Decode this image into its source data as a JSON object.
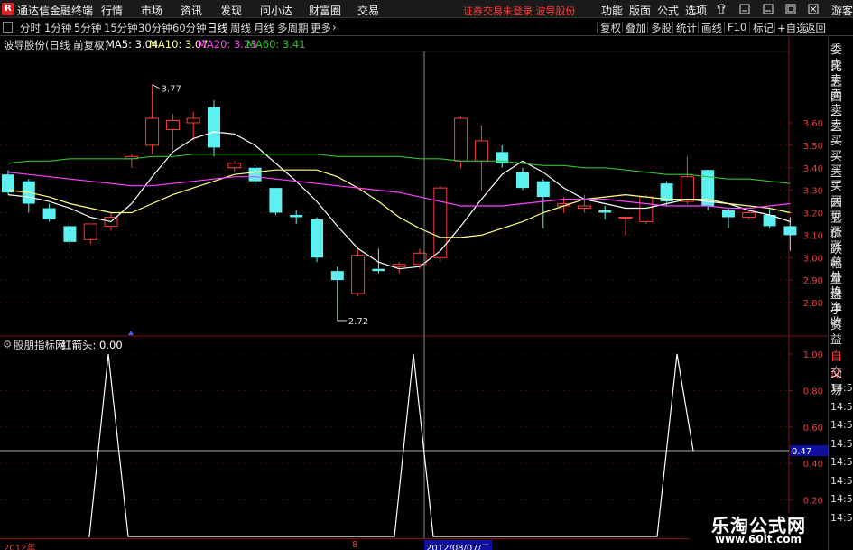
{
  "menubar": {
    "logo": "R",
    "app_title": "通达信金融终端",
    "menus": [
      "行情",
      "市场",
      "资讯",
      "发现",
      "问小达",
      "财富圈",
      "交易"
    ],
    "notice": "证券交易未登录  波导股份",
    "right_menus": [
      "功能",
      "版面",
      "公式",
      "选项"
    ],
    "guest": "游客"
  },
  "toolbar": {
    "periods": [
      "分时",
      "1分钟",
      "5分钟",
      "15分钟",
      "30分钟",
      "60分钟",
      "日线",
      "周线",
      "月线",
      "多周期",
      "更多"
    ],
    "active_period": "日线",
    "right_tools": [
      "复权",
      "叠加",
      "多股",
      "统计",
      "画线",
      "F10",
      "标记",
      "+自选",
      "返回"
    ]
  },
  "info": {
    "stock": "波导股份(日线 前复权)",
    "ma5_label": "MA5: 3.04",
    "ma10_label": "MA10: 3.07",
    "ma20_label": "MA20: 3.23",
    "ma60_label": "MA60: 3.41"
  },
  "indicator": {
    "name": "股朋指标网",
    "value_label": "红箭头: 0.00"
  },
  "right_panel": {
    "items": [
      "委比",
      "卖五",
      "卖四",
      "卖三",
      "卖二",
      "卖一",
      "买一",
      "买二",
      "买三",
      "买四",
      "买五",
      "现价",
      "涨跌",
      "涨幅",
      "总量",
      "外盘",
      "换手",
      "净资",
      "收益"
    ],
    "lower_items": [
      "自动",
      "交易"
    ],
    "times": [
      "14:56",
      "14:56",
      "14:56",
      "14:56",
      "14:56",
      "14:56",
      "14:56",
      "14:56"
    ]
  },
  "price_axis": [
    "3.60",
    "3.50",
    "3.40",
    "3.30",
    "3.20",
    "3.10",
    "3.00",
    "2.90",
    "2.80"
  ],
  "ind_axis": [
    "1.00",
    "0.80",
    "0.60",
    "0.40",
    "0.20"
  ],
  "crosshair_value": "0.47",
  "date_bar": {
    "year": "2012年",
    "month": "8",
    "cursor_date": "2012/08/07/二"
  },
  "colors": {
    "up": "#ff3b3b",
    "down": "#5cf0f0",
    "ma5": "#ffffff",
    "ma10": "#ffff80",
    "ma20": "#ff40ff",
    "ma60": "#30c030",
    "frame": "#7a1010"
  },
  "watermark": {
    "line1": "乐淘公式网",
    "line2": "www.60lt.com"
  },
  "chart_data": {
    "type": "candlestick",
    "price_axis_range": [
      2.7,
      3.78
    ],
    "high_label": "3.77",
    "low_label": "2.72",
    "candles": [
      {
        "o": 3.37,
        "h": 3.39,
        "l": 3.28,
        "c": 3.29
      },
      {
        "o": 3.34,
        "h": 3.35,
        "l": 3.2,
        "c": 3.24
      },
      {
        "o": 3.22,
        "h": 3.24,
        "l": 3.16,
        "c": 3.17
      },
      {
        "o": 3.14,
        "h": 3.16,
        "l": 3.04,
        "c": 3.07
      },
      {
        "o": 3.08,
        "h": 3.15,
        "l": 3.06,
        "c": 3.15
      },
      {
        "o": 3.14,
        "h": 3.2,
        "l": 3.12,
        "c": 3.18
      },
      {
        "o": 3.44,
        "h": 3.46,
        "l": 3.4,
        "c": 3.45
      },
      {
        "o": 3.5,
        "h": 3.77,
        "l": 3.46,
        "c": 3.62
      },
      {
        "o": 3.57,
        "h": 3.64,
        "l": 3.48,
        "c": 3.61
      },
      {
        "o": 3.6,
        "h": 3.65,
        "l": 3.52,
        "c": 3.62
      },
      {
        "o": 3.67,
        "h": 3.7,
        "l": 3.45,
        "c": 3.49
      },
      {
        "o": 3.4,
        "h": 3.43,
        "l": 3.38,
        "c": 3.42
      },
      {
        "o": 3.4,
        "h": 3.41,
        "l": 3.32,
        "c": 3.34
      },
      {
        "o": 3.31,
        "h": 3.31,
        "l": 3.19,
        "c": 3.2
      },
      {
        "o": 3.19,
        "h": 3.21,
        "l": 3.15,
        "c": 3.18
      },
      {
        "o": 3.17,
        "h": 3.18,
        "l": 2.98,
        "c": 3.0
      },
      {
        "o": 2.94,
        "h": 2.96,
        "l": 2.72,
        "c": 2.9
      },
      {
        "o": 2.84,
        "h": 3.04,
        "l": 2.83,
        "c": 3.01
      },
      {
        "o": 2.95,
        "h": 3.04,
        "l": 2.93,
        "c": 2.94
      },
      {
        "o": 2.96,
        "h": 2.98,
        "l": 2.93,
        "c": 2.97
      },
      {
        "o": 2.97,
        "h": 3.04,
        "l": 2.95,
        "c": 3.02
      },
      {
        "o": 3.0,
        "h": 3.32,
        "l": 2.98,
        "c": 3.31
      },
      {
        "o": 3.43,
        "h": 3.63,
        "l": 3.4,
        "c": 3.62
      },
      {
        "o": 3.43,
        "h": 3.59,
        "l": 3.3,
        "c": 3.52
      },
      {
        "o": 3.47,
        "h": 3.5,
        "l": 3.4,
        "c": 3.42
      },
      {
        "o": 3.38,
        "h": 3.4,
        "l": 3.3,
        "c": 3.31
      },
      {
        "o": 3.34,
        "h": 3.35,
        "l": 3.13,
        "c": 3.27
      },
      {
        "o": 3.23,
        "h": 3.27,
        "l": 3.2,
        "c": 3.24
      },
      {
        "o": 3.22,
        "h": 3.28,
        "l": 3.2,
        "c": 3.23
      },
      {
        "o": 3.21,
        "h": 3.23,
        "l": 3.17,
        "c": 3.2
      },
      {
        "o": 3.18,
        "h": 3.18,
        "l": 3.1,
        "c": 3.18
      },
      {
        "o": 3.16,
        "h": 3.28,
        "l": 3.15,
        "c": 3.27
      },
      {
        "o": 3.33,
        "h": 3.34,
        "l": 3.23,
        "c": 3.25
      },
      {
        "o": 3.25,
        "h": 3.45,
        "l": 3.24,
        "c": 3.36
      },
      {
        "o": 3.39,
        "h": 3.39,
        "l": 3.21,
        "c": 3.23
      },
      {
        "o": 3.21,
        "h": 3.22,
        "l": 3.13,
        "c": 3.18
      },
      {
        "o": 3.18,
        "h": 3.21,
        "l": 3.17,
        "c": 3.2
      },
      {
        "o": 3.19,
        "h": 3.22,
        "l": 3.13,
        "c": 3.14
      },
      {
        "o": 3.14,
        "h": 3.18,
        "l": 3.03,
        "c": 3.1
      }
    ],
    "ma_series": [
      {
        "name": "MA5",
        "values": [
          3.28,
          3.27,
          3.25,
          3.22,
          3.18,
          3.16,
          3.24,
          3.36,
          3.47,
          3.53,
          3.56,
          3.55,
          3.5,
          3.42,
          3.34,
          3.25,
          3.14,
          3.04,
          2.98,
          2.95,
          2.96,
          3.03,
          3.14,
          3.26,
          3.37,
          3.43,
          3.38,
          3.31,
          3.26,
          3.24,
          3.22,
          3.22,
          3.24,
          3.26,
          3.25,
          3.24,
          3.21,
          3.19,
          3.16
        ]
      },
      {
        "name": "MA10",
        "values": [
          3.3,
          3.29,
          3.27,
          3.24,
          3.22,
          3.2,
          3.2,
          3.24,
          3.28,
          3.31,
          3.34,
          3.37,
          3.38,
          3.39,
          3.39,
          3.39,
          3.36,
          3.31,
          3.25,
          3.18,
          3.13,
          3.09,
          3.09,
          3.1,
          3.13,
          3.16,
          3.2,
          3.23,
          3.26,
          3.27,
          3.28,
          3.27,
          3.26,
          3.26,
          3.26,
          3.24,
          3.23,
          3.22,
          3.2
        ]
      },
      {
        "name": "MA20",
        "values": [
          3.38,
          3.37,
          3.36,
          3.35,
          3.34,
          3.33,
          3.32,
          3.32,
          3.33,
          3.34,
          3.35,
          3.36,
          3.36,
          3.35,
          3.34,
          3.33,
          3.32,
          3.31,
          3.3,
          3.29,
          3.27,
          3.25,
          3.23,
          3.23,
          3.23,
          3.24,
          3.25,
          3.26,
          3.26,
          3.26,
          3.25,
          3.24,
          3.23,
          3.23,
          3.23,
          3.22,
          3.22,
          3.23,
          3.24
        ]
      },
      {
        "name": "MA60",
        "values": [
          3.42,
          3.43,
          3.43,
          3.44,
          3.44,
          3.44,
          3.44,
          3.45,
          3.45,
          3.46,
          3.46,
          3.46,
          3.46,
          3.46,
          3.46,
          3.46,
          3.45,
          3.45,
          3.45,
          3.45,
          3.44,
          3.44,
          3.43,
          3.43,
          3.43,
          3.42,
          3.41,
          3.41,
          3.4,
          3.4,
          3.39,
          3.38,
          3.37,
          3.37,
          3.36,
          3.35,
          3.35,
          3.34,
          3.33
        ]
      }
    ],
    "indicator_series": {
      "name": "红箭头",
      "range": [
        0,
        1.0
      ],
      "points": [
        [
          0,
          0
        ],
        [
          4,
          0
        ],
        [
          5,
          1
        ],
        [
          6,
          0
        ],
        [
          19,
          0
        ],
        [
          20,
          1
        ],
        [
          21,
          0
        ],
        [
          31,
          0
        ],
        [
          32,
          1
        ],
        [
          33,
          0.47
        ]
      ]
    },
    "crosshair_y_value": 0.47
  }
}
